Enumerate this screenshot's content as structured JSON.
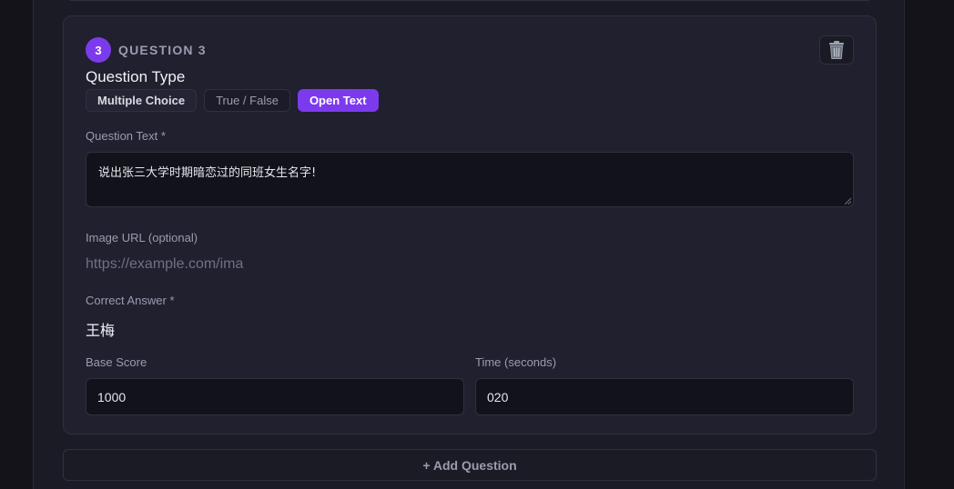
{
  "question": {
    "number": "3",
    "title": "QUESTION 3",
    "type_label": "Question Type",
    "types": [
      {
        "label": "Multiple Choice"
      },
      {
        "label": "True / False"
      },
      {
        "label": "Open Text"
      }
    ],
    "active_type": "Open Text",
    "text_label": "Question Text *",
    "text_value": "说出张三大学时期暗恋过的同班女生名字!",
    "image_label": "Image URL (optional)",
    "image_placeholder": "https://example.com/ima",
    "answer_label": "Correct Answer *",
    "answer_value": "王梅",
    "base_score_label": "Base Score",
    "base_score_value": "1000",
    "time_label": "Time (seconds)",
    "time_value": "020",
    "delete_icon": "trash-icon"
  },
  "add_question_label": "+ Add Question",
  "colors": {
    "accent": "#7c3aed",
    "background": "#131319",
    "card": "#20202f"
  }
}
